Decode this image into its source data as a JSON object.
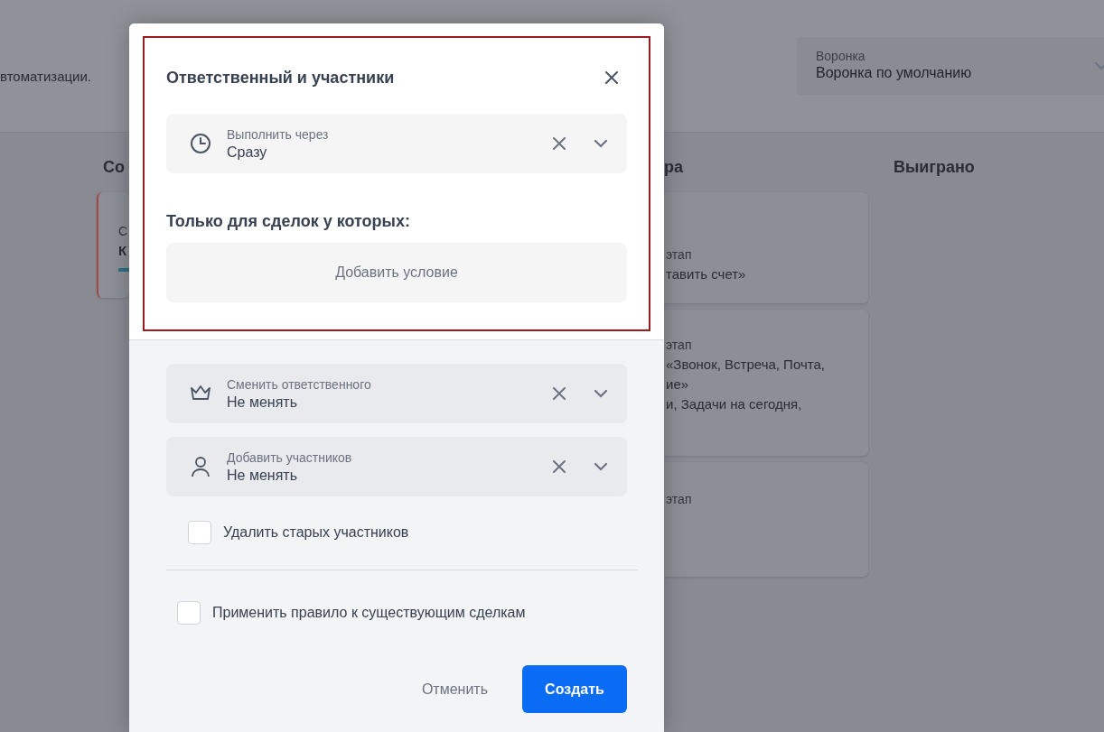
{
  "background": {
    "header_text": "втоматизации.",
    "pipeline_select": {
      "label": "Воронка",
      "value": "Воронка по умолчанию"
    },
    "columns": [
      {
        "title": "Со",
        "cards": [
          {
            "flagged": true,
            "progress": true,
            "lines": [
              {
                "kind": "caption",
                "text": "С"
              },
              {
                "kind": "value",
                "text": "К"
              }
            ]
          }
        ]
      },
      {
        "title": "ра",
        "cards": [
          {
            "flagged": false,
            "progress": false,
            "lines": [
              {
                "kind": "caption",
                "text": "этап"
              },
              {
                "kind": "value",
                "text": "тавить счет»"
              }
            ]
          },
          {
            "flagged": false,
            "progress": false,
            "lines": [
              {
                "kind": "caption",
                "text": "этап"
              },
              {
                "kind": "value",
                "text": "«Звонок, Встреча, Почта,"
              },
              {
                "kind": "value",
                "text": "ие»"
              },
              {
                "kind": "value",
                "text": "и, Задачи на сегодня,"
              }
            ]
          },
          {
            "flagged": false,
            "progress": false,
            "lines": [
              {
                "kind": "caption",
                "text": "этап"
              }
            ]
          }
        ]
      },
      {
        "title": "Выиграно"
      }
    ]
  },
  "dialog": {
    "title": "Ответственный и участники",
    "highlighted": true,
    "fields": [
      {
        "kind": "delay",
        "label": "Выполнить через",
        "value": "Сразу"
      }
    ],
    "condition_heading": "Только для сделок у которых:",
    "add_condition_button": "Добавить условие",
    "action_fields": [
      {
        "kind": "responsible",
        "label": "Сменить ответственного",
        "value": "Не менять"
      },
      {
        "kind": "participants",
        "label": "Добавить участников",
        "value": "Не менять"
      }
    ],
    "remove_old_checkbox": {
      "label": "Удалить старых участников",
      "checked": false
    },
    "apply_existing_checkbox": {
      "label": "Применить правило к существующим сделкам",
      "checked": false
    },
    "buttons": [
      {
        "kind": "secondary",
        "label": "Отменить"
      },
      {
        "kind": "primary",
        "label": "Создать"
      }
    ]
  }
}
